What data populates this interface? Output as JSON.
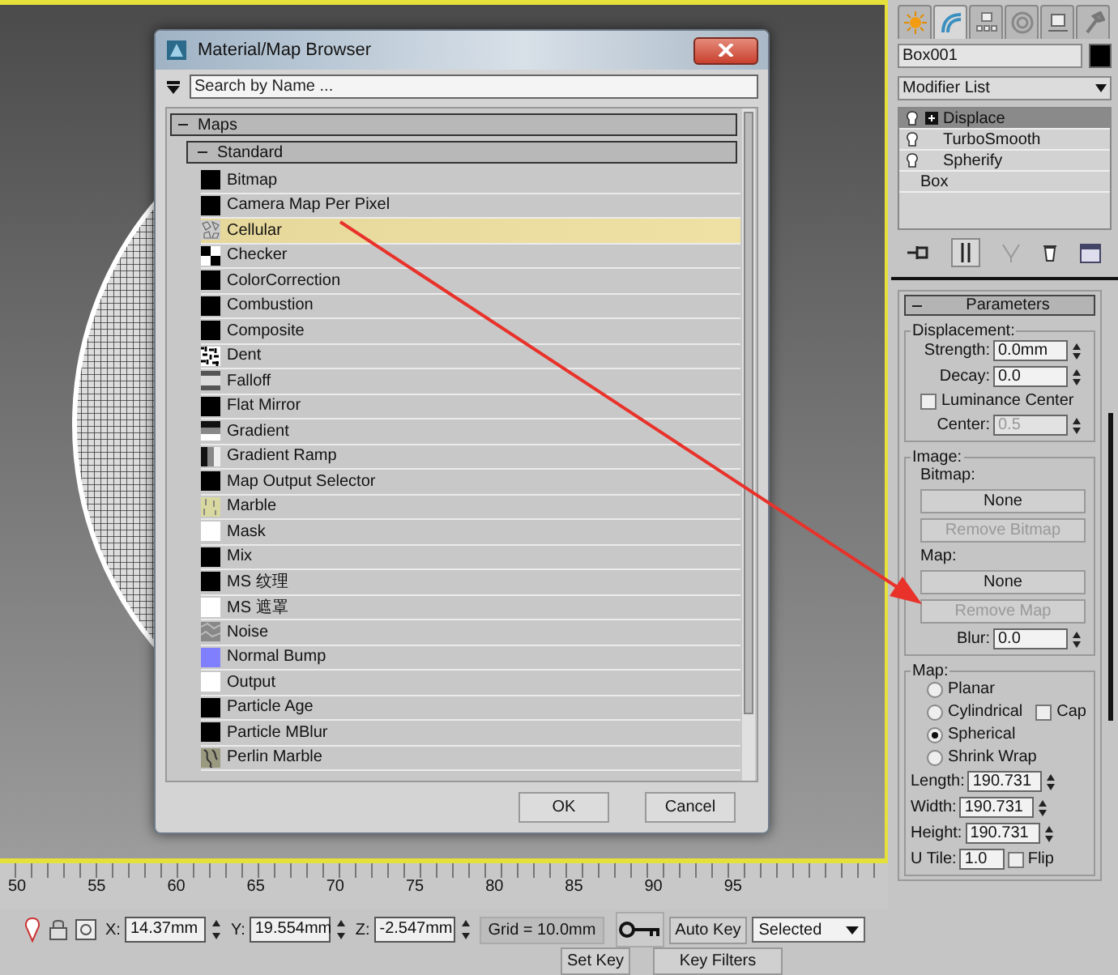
{
  "dialog": {
    "title": "Material/Map Browser",
    "search": {
      "placeholder": "Search by Name ..."
    },
    "category": {
      "label": "Maps",
      "expanded": true
    },
    "subcategory": {
      "label": "Standard",
      "expanded": true
    },
    "maps": [
      {
        "name": "Bitmap",
        "kind": "solid",
        "color": "#000000",
        "selected": false
      },
      {
        "name": "Camera Map Per Pixel",
        "kind": "solid",
        "color": "#000000",
        "selected": false
      },
      {
        "name": "Cellular",
        "kind": "cellular",
        "selected": true
      },
      {
        "name": "Checker",
        "kind": "checker",
        "selected": false
      },
      {
        "name": "ColorCorrection",
        "kind": "solid",
        "color": "#000000",
        "selected": false
      },
      {
        "name": "Combustion",
        "kind": "solid",
        "color": "#000000",
        "selected": false
      },
      {
        "name": "Composite",
        "kind": "solid",
        "color": "#000000",
        "selected": false
      },
      {
        "name": "Dent",
        "kind": "dent",
        "selected": false
      },
      {
        "name": "Falloff",
        "kind": "falloff",
        "selected": false
      },
      {
        "name": "Flat Mirror",
        "kind": "solid",
        "color": "#000000",
        "selected": false
      },
      {
        "name": "Gradient",
        "kind": "gradient",
        "selected": false
      },
      {
        "name": "Gradient Ramp",
        "kind": "ramp",
        "selected": false
      },
      {
        "name": "Map Output Selector",
        "kind": "solid",
        "color": "#000000",
        "selected": false
      },
      {
        "name": "Marble",
        "kind": "marble",
        "selected": false
      },
      {
        "name": "Mask",
        "kind": "solid",
        "color": "#ffffff",
        "selected": false
      },
      {
        "name": "Mix",
        "kind": "solid",
        "color": "#000000",
        "selected": false
      },
      {
        "name": "MS 纹理",
        "kind": "solid",
        "color": "#000000",
        "selected": false
      },
      {
        "name": "MS 遮罩",
        "kind": "solid",
        "color": "#ffffff",
        "selected": false
      },
      {
        "name": "Noise",
        "kind": "noise",
        "selected": false
      },
      {
        "name": "Normal Bump",
        "kind": "solid",
        "color": "#8080ff",
        "selected": false
      },
      {
        "name": "Output",
        "kind": "solid",
        "color": "#ffffff",
        "selected": false
      },
      {
        "name": "Particle Age",
        "kind": "solid",
        "color": "#000000",
        "selected": false
      },
      {
        "name": "Particle MBlur",
        "kind": "solid",
        "color": "#000000",
        "selected": false
      },
      {
        "name": "Perlin Marble",
        "kind": "perlin",
        "selected": false
      }
    ],
    "buttons": [
      "OK",
      "Cancel"
    ]
  },
  "command_panel": {
    "tabs": [
      {
        "kind": "create",
        "selected": false
      },
      {
        "kind": "modify",
        "selected": true
      },
      {
        "kind": "hierarchy",
        "selected": false
      },
      {
        "kind": "motion",
        "selected": false
      },
      {
        "kind": "display",
        "selected": false
      },
      {
        "kind": "utilities",
        "selected": false
      }
    ],
    "object_name": "Box001",
    "modifier_list": "Modifier List",
    "stack": [
      {
        "label": "Displace",
        "light": true,
        "expandable": true,
        "selected": true
      },
      {
        "label": "TurboSmooth",
        "light": true,
        "expandable": false,
        "selected": false
      },
      {
        "label": "Spherify",
        "light": true,
        "expandable": false,
        "selected": false
      },
      {
        "label": "Box",
        "light": false,
        "expandable": false,
        "selected": false
      }
    ],
    "rollout": {
      "title": "Parameters",
      "expanded": true
    },
    "displacement": {
      "title": "Displacement:",
      "strength": {
        "label": "Strength:",
        "value": "0.0mm"
      },
      "decay": {
        "label": "Decay:",
        "value": "0.0"
      },
      "luminance_center": {
        "label": "Luminance Center",
        "checked": false
      },
      "center": {
        "label": "Center:",
        "value": "0.5",
        "disabled": true
      }
    },
    "image": {
      "title": "Image:",
      "bitmap_label": "Bitmap:",
      "bitmap_button": "None",
      "remove_bitmap": {
        "label": "Remove Bitmap",
        "disabled": true
      },
      "map_label": "Map:",
      "map_button": "None",
      "remove_map": {
        "label": "Remove Map",
        "disabled": true
      },
      "blur": {
        "label": "Blur:",
        "value": "0.0"
      }
    },
    "map": {
      "title": "Map:",
      "projections": [
        {
          "label": "Planar",
          "selected": false
        },
        {
          "label": "Cylindrical",
          "selected": false
        },
        {
          "label": "Spherical",
          "selected": true
        },
        {
          "label": "Shrink Wrap",
          "selected": false
        }
      ],
      "cap": {
        "label": "Cap",
        "checked": false
      },
      "sizes": [
        {
          "label": "Length:",
          "value": "190.731"
        },
        {
          "label": "Width:",
          "value": "190.731"
        },
        {
          "label": "Height:",
          "value": "190.731"
        }
      ],
      "u_tile": {
        "label": "U Tile:",
        "value": "1.0"
      },
      "flip": {
        "label": "Flip",
        "checked": false
      }
    }
  },
  "ruler_labels": [
    "50",
    "55",
    "60",
    "65",
    "70",
    "75",
    "80",
    "85",
    "90",
    "95"
  ],
  "status_bar": {
    "coords": [
      {
        "label": "X:",
        "value": "14.37mm"
      },
      {
        "label": "Y:",
        "value": "19.554mm"
      },
      {
        "label": "Z:",
        "value": "-2.547mm"
      }
    ],
    "grid": "Grid = 10.0mm",
    "auto_key": "Auto Key",
    "key_mode": "Selected",
    "set_key": "Set Key",
    "key_filters": "Key Filters"
  }
}
